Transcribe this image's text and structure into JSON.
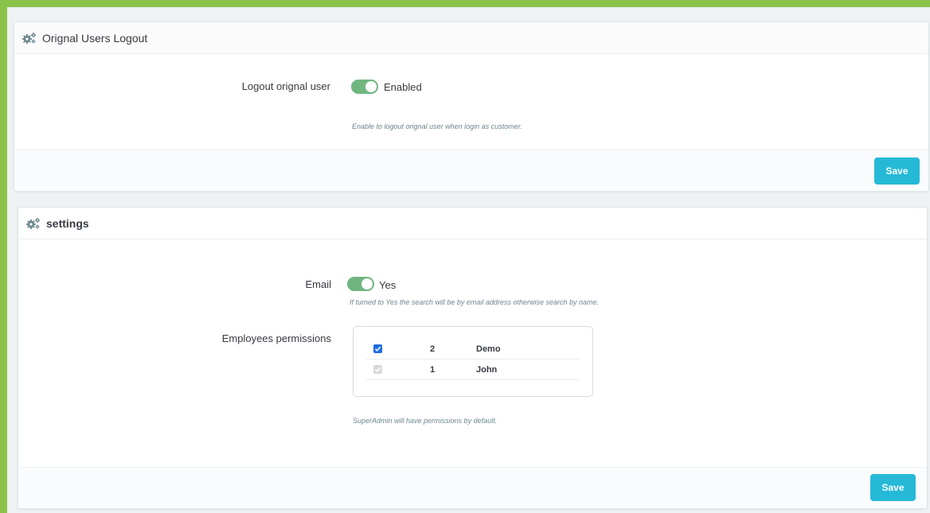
{
  "colors": {
    "frame": "#8bc34a",
    "accent": "#25b9d7",
    "switch_on": "#70b580",
    "checkbox_checked": "#1e6ee0"
  },
  "panel1": {
    "icon": "cogs-icon",
    "title": "Orignal Users Logout",
    "field": {
      "label": "Logout orignal user",
      "state": "on",
      "state_label": "Enabled",
      "help": "Enable to logout orignal user when login as customer."
    },
    "save_label": "Save"
  },
  "panel2": {
    "icon": "cogs-icon",
    "title": "settings",
    "email": {
      "label": "Email",
      "state": "on",
      "state_label": "Yes",
      "help": "If turned to Yes the search will be by email address otherwise search by name."
    },
    "permissions": {
      "label": "Employees permissions",
      "rows": [
        {
          "id": "2",
          "name": "Demo",
          "checked": true,
          "disabled": false
        },
        {
          "id": "1",
          "name": "John",
          "checked": true,
          "disabled": true
        }
      ],
      "help": "SuperAdmin will have permissions by default."
    },
    "save_label": "Save"
  }
}
